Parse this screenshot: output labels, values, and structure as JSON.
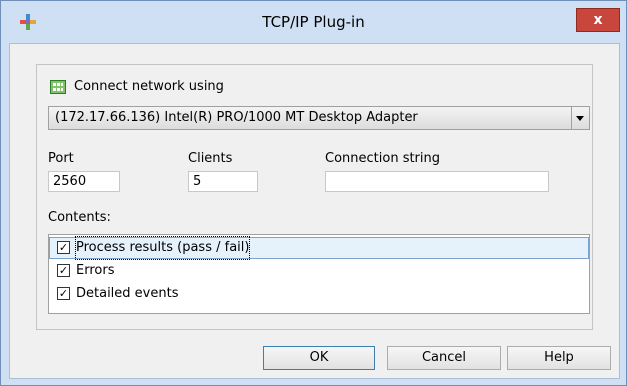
{
  "window": {
    "title": "TCP/IP Plug-in",
    "app_icon": "plugin-icon",
    "close_label": "x"
  },
  "network": {
    "label": "Connect network using",
    "icon": "network-adapter-icon",
    "selected_adapter": "(172.17.66.136) Intel(R) PRO/1000 MT Desktop Adapter"
  },
  "fields": {
    "port_label": "Port",
    "port_value": "2560",
    "clients_label": "Clients",
    "clients_value": "5",
    "connection_label": "Connection string",
    "connection_value": ""
  },
  "contents": {
    "label": "Contents:",
    "items": [
      {
        "label": "Process results (pass / fail)",
        "checked": true,
        "selected": true
      },
      {
        "label": "Errors",
        "checked": true,
        "selected": false
      },
      {
        "label": "Detailed events",
        "checked": true,
        "selected": false
      }
    ]
  },
  "buttons": {
    "ok": "OK",
    "cancel": "Cancel",
    "help": "Help"
  },
  "colors": {
    "window_frame": "#cfe0f4",
    "close_button": "#c9463d",
    "selection": "#e5f1fb"
  }
}
